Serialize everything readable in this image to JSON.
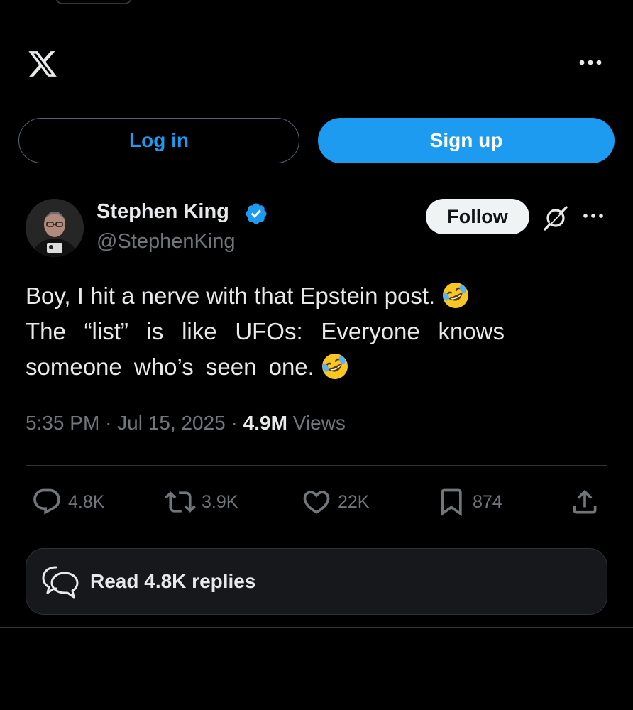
{
  "header": {
    "logo_icon": "x-logo-icon",
    "more_icon": "more-horizontal-icon"
  },
  "auth": {
    "login_label": "Log in",
    "signup_label": "Sign up"
  },
  "post": {
    "author": {
      "name": "Stephen King",
      "handle": "@StephenKing",
      "verified": true
    },
    "follow_label": "Follow",
    "text_lines": [
      "Boy, I hit a nerve with that Epstein post.",
      "The “list” is like UFOs: Everyone knows",
      "someone who’s seen one."
    ],
    "time": "5:35 PM",
    "separator": "·",
    "date": "Jul 15, 2025",
    "views_count": "4.9M",
    "views_label": "Views",
    "stats": {
      "replies": "4.8K",
      "reposts": "3.9K",
      "likes": "22K",
      "bookmarks": "874"
    },
    "read_replies_label": "Read 4.8K replies"
  },
  "colors": {
    "background": "#000000",
    "accent": "#1d9bf0",
    "text": "#e7e9ea",
    "muted": "#71767b",
    "border": "#2f3336"
  }
}
